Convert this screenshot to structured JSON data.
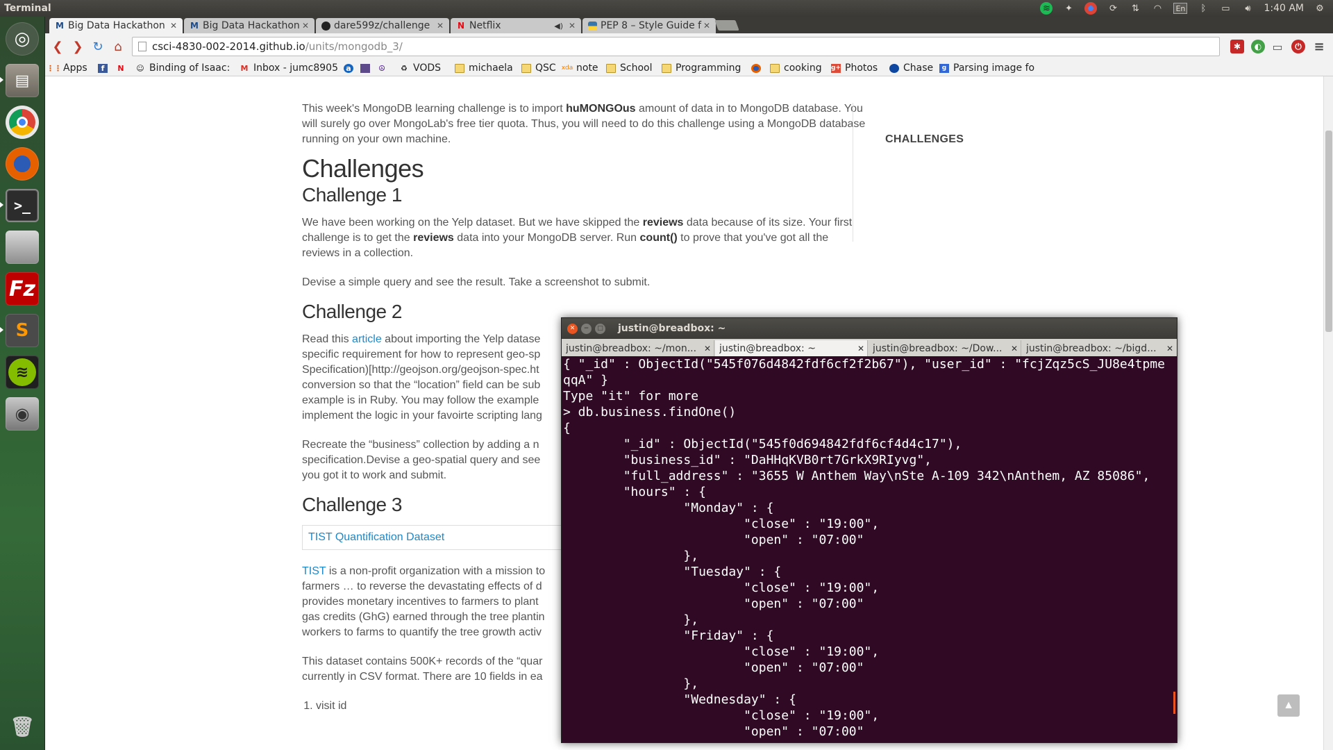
{
  "top_panel": {
    "app_title": "Terminal",
    "lang": "En",
    "time": "1:40 AM"
  },
  "launcher": {
    "items": [
      "dash-home",
      "files",
      "chrome",
      "firefox",
      "terminal",
      "disk",
      "filezilla",
      "sublime-text",
      "spotify",
      "camera",
      "trash"
    ]
  },
  "browser": {
    "tabs": [
      {
        "label": "Big Data Hackathon",
        "icon": "M"
      },
      {
        "label": "Big Data Hackathon",
        "icon": "M"
      },
      {
        "label": "dare599z/challenge",
        "icon": "github"
      },
      {
        "label": "Netflix",
        "icon": "N"
      },
      {
        "label": "PEP 8 – Style Guide f",
        "icon": "python"
      }
    ],
    "url_host": "csci-4830-002-2014.github.io",
    "url_path": "/units/mongodb_3/",
    "bookmarks": [
      {
        "label": "Apps",
        "icon": "apps-icon"
      },
      {
        "label": "",
        "icon": "facebook-icon"
      },
      {
        "label": "",
        "icon": "netflix-icon"
      },
      {
        "label": "Binding of Isaac:",
        "icon": "isaac-icon"
      },
      {
        "label": "Inbox - jumc8905",
        "icon": "gmail-icon"
      },
      {
        "label": "",
        "icon": "ext1-icon"
      },
      {
        "label": "",
        "icon": "calendar-icon"
      },
      {
        "label": "",
        "icon": "peace-icon"
      },
      {
        "label": "VODS",
        "icon": "vods-icon"
      },
      {
        "label": "michaela",
        "icon": "folder-icon"
      },
      {
        "label": "QSC",
        "icon": "folder-icon"
      },
      {
        "label": "note",
        "icon": "xda-icon"
      },
      {
        "label": "School",
        "icon": "folder-icon"
      },
      {
        "label": "Programming",
        "icon": "folder-icon"
      },
      {
        "label": "",
        "icon": "firefox-icon"
      },
      {
        "label": "cooking",
        "icon": "folder-icon"
      },
      {
        "label": "Photos",
        "icon": "gplus-icon"
      },
      {
        "label": "Chase",
        "icon": "chase-icon"
      },
      {
        "label": "Parsing image fo",
        "icon": "doc-icon"
      }
    ]
  },
  "page": {
    "intro": {
      "before": "This week's MongoDB learning challenge is to import ",
      "bold": "huMONGOus",
      "after": " amount of data in to MongoDB database. You will surely go over MongoLab's free tier quota. Thus, you will need to do this challenge using a MongoDB database running on your own machine."
    },
    "h_challenges": "Challenges",
    "c1": {
      "heading": "Challenge 1",
      "p1_a": "We have been working on the Yelp dataset. But we have skipped the ",
      "p1_b": "reviews",
      "p1_c": " data because of its size. Your first challenge is to get the ",
      "p1_d": "reviews",
      "p1_e": " data into your MongoDB server. Run ",
      "p1_f": "count()",
      "p1_g": " to prove that you've got all the reviews in a collection.",
      "p2": "Devise a simple query and see the result. Take a screenshot to submit."
    },
    "c2": {
      "heading": "Challenge 2",
      "lines": [
        "Read this ",
        "specific requirement for how to represent geo-sp",
        "Specification)[http://geojson.org/geojson-spec.ht",
        "conversion so that the “location” field can be sub",
        "example is in Ruby. You may follow the example",
        "implement the logic in your favoirte scripting lang"
      ],
      "link": "article",
      "line1_after": " about importing the Yelp datase",
      "p2_lines": [
        "Recreate the “business” collection by adding a n",
        "specification.Devise a geo-spatial query and see",
        "you got it to work and submit."
      ]
    },
    "c3": {
      "heading": "Challenge 3",
      "dataset_link": "TIST Quantification Dataset",
      "tist_link": "TIST",
      "p1_lines": [
        " is a non-profit organization with a mission to",
        "farmers … to reverse the devastating effects of d",
        "provides monetary incentives to farmers to plant",
        "gas credits (GhG) earned through the tree plantin",
        "workers to farms to quantify the tree growth activ"
      ],
      "p2_lines": [
        "This dataset contains 500K+ records of the “quar",
        "currently in CSV format. There are 10 fields in ea"
      ],
      "list_item_1": "visit id"
    },
    "sidebar_heading": "CHALLENGES"
  },
  "terminal": {
    "title": "justin@breadbox: ~",
    "tabs": [
      "justin@breadbox: ~/mon...",
      "justin@breadbox: ~",
      "justin@breadbox: ~/Dow...",
      "justin@breadbox: ~/bigd..."
    ],
    "lines": [
      "{ \"_id\" : ObjectId(\"545f076d4842fdf6cf2f2b67\"), \"user_id\" : \"fcjZqz5cS_JU8e4tpme",
      "qqA\" }",
      "Type \"it\" for more",
      "> db.business.findOne()",
      "{",
      "        \"_id\" : ObjectId(\"545f0d694842fdf6cf4d4c17\"),",
      "        \"business_id\" : \"DaHHqKVB0rt7GrkX9RIyvg\",",
      "        \"full_address\" : \"3655 W Anthem Way\\nSte A-109 342\\nAnthem, AZ 85086\",",
      "        \"hours\" : {",
      "                \"Monday\" : {",
      "                        \"close\" : \"19:00\",",
      "                        \"open\" : \"07:00\"",
      "                },",
      "                \"Tuesday\" : {",
      "                        \"close\" : \"19:00\",",
      "                        \"open\" : \"07:00\"",
      "                },",
      "                \"Friday\" : {",
      "                        \"close\" : \"19:00\",",
      "                        \"open\" : \"07:00\"",
      "                },",
      "                \"Wednesday\" : {",
      "                        \"close\" : \"19:00\",",
      "                        \"open\" : \"07:00\""
    ]
  },
  "colors": {
    "terminal_bg": "#300a24",
    "link": "#1e88c9",
    "ubuntu_orange": "#e95420"
  }
}
